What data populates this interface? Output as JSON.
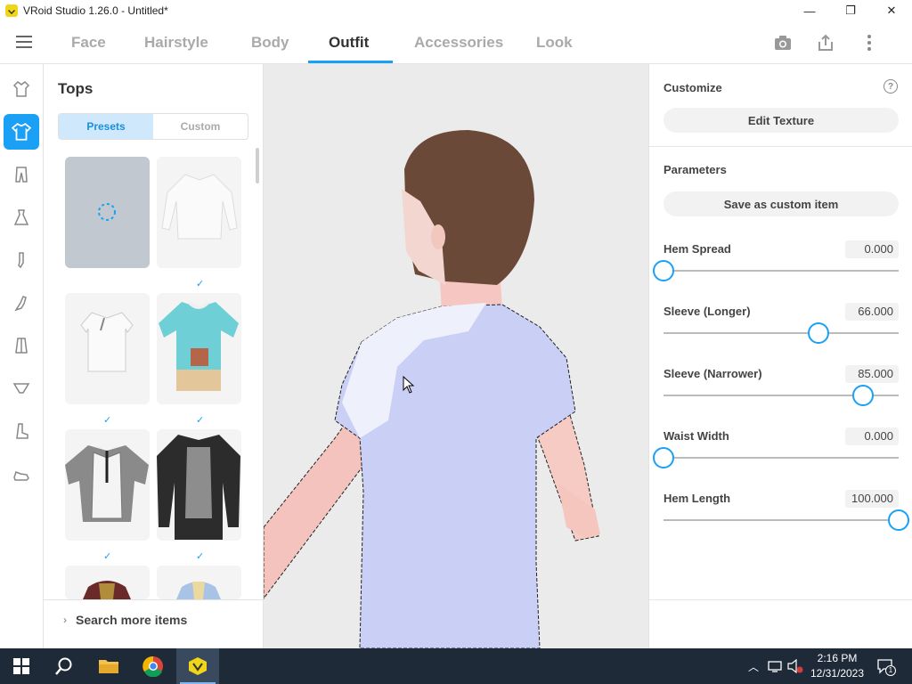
{
  "window": {
    "title": "VRoid Studio 1.26.0 - Untitled*",
    "minimize": "—",
    "maximize": "❐",
    "close": "✕"
  },
  "nav": {
    "tabs": [
      "Face",
      "Hairstyle",
      "Body",
      "Outfit",
      "Accessories",
      "Look"
    ],
    "active_tab": "Outfit"
  },
  "tops": {
    "title": "Tops",
    "segments": [
      "Presets",
      "Custom"
    ],
    "active_segment": "Presets",
    "search_more": "Search more items",
    "check": "✓"
  },
  "customize": {
    "title": "Customize",
    "help": "?",
    "edit_texture": "Edit Texture"
  },
  "parameters": {
    "title": "Parameters",
    "save_custom": "Save as custom item",
    "items": [
      {
        "label": "Hem Spread",
        "value": "0.000",
        "level": 0.0
      },
      {
        "label": "Sleeve (Longer)",
        "value": "66.000",
        "level": 0.66
      },
      {
        "label": "Sleeve (Narrower)",
        "value": "85.000",
        "level": 0.85
      },
      {
        "label": "Waist Width",
        "value": "0.000",
        "level": 0.0
      },
      {
        "label": "Hem Length",
        "value": "100.000",
        "level": 1.0
      }
    ]
  },
  "taskbar": {
    "time": "2:16 PM",
    "date": "12/31/2023",
    "notification_count": "1"
  },
  "colors": {
    "accent": "#1aa0f5",
    "taskbar": "#1f2a38"
  }
}
